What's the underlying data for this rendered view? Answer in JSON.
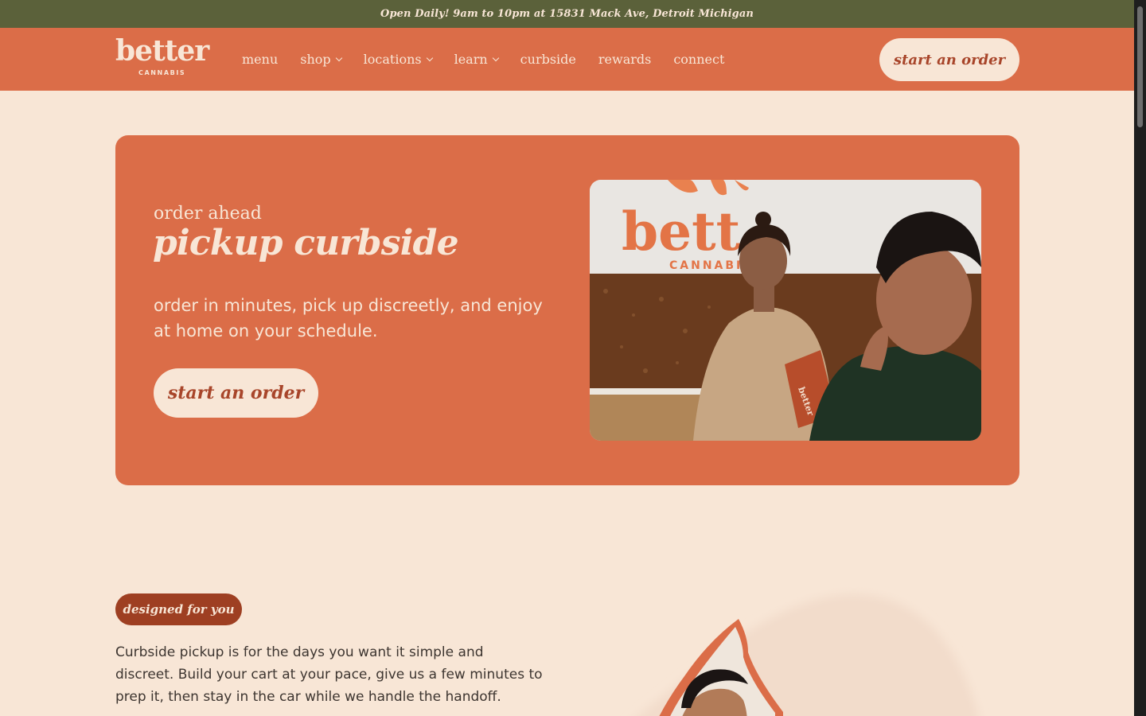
{
  "announcement": "Open Daily! 9am to 10pm at 15831 Mack Ave, Detroit Michigan",
  "brand": {
    "name": "better",
    "sub": "CANNABIS"
  },
  "nav": {
    "items": [
      {
        "label": "menu",
        "has_dropdown": false
      },
      {
        "label": "shop",
        "has_dropdown": true
      },
      {
        "label": "locations",
        "has_dropdown": true
      },
      {
        "label": "learn",
        "has_dropdown": true
      },
      {
        "label": "curbside",
        "has_dropdown": false
      },
      {
        "label": "rewards",
        "has_dropdown": false
      },
      {
        "label": "connect",
        "has_dropdown": false
      }
    ],
    "cta": "start an order"
  },
  "hero": {
    "eyebrow": "order ahead",
    "title": "pickup curbside",
    "body": "order in minutes, pick up discreetly, and enjoy at home on your schedule.",
    "cta": "start an order",
    "photo_sign": {
      "word": "bett",
      "sub": "CANNABI",
      "bag_label": "better"
    }
  },
  "section": {
    "tag": "designed for you",
    "body": "Curbside pickup is for the days you want it simple and discreet. Build your cart at your pace, give us a few minutes to prep it, then stay in the car while we handle the handoff."
  },
  "colors": {
    "background": "#f8e6d6",
    "announcement_bar": "#5b613a",
    "primary_orange": "#db6d48",
    "dark_rust": "#9e3f22",
    "cream": "#f8e6d6"
  }
}
